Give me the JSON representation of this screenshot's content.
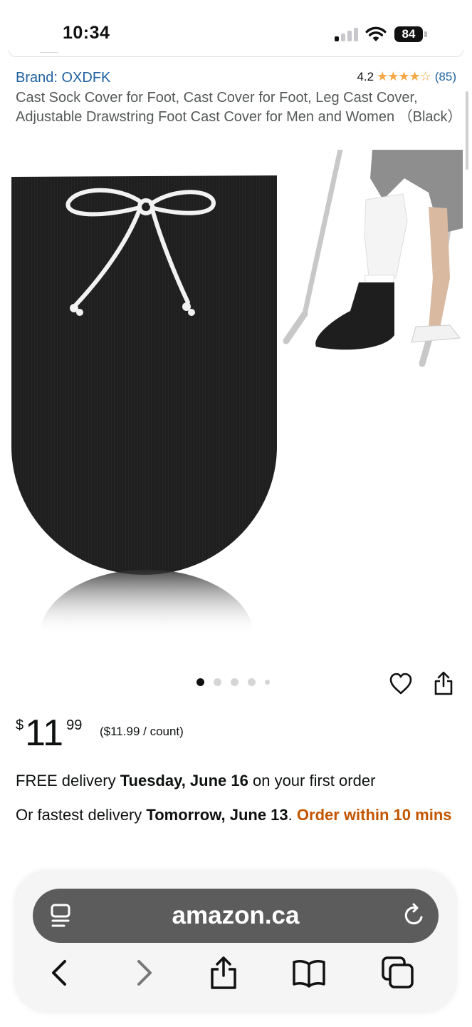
{
  "status": {
    "time": "10:34",
    "battery": "84"
  },
  "product": {
    "brand": "Brand: OXDFK",
    "rating_value": "4.2",
    "rating_stars": 4.2,
    "rating_count": "(85)",
    "title": "Cast Sock Cover for Foot, Cast Cover for Foot, Leg Cast Cover, Adjustable Drawstring Foot Cast Cover for Men and Women （Black）"
  },
  "gallery": {
    "count": 5,
    "active_index": 0
  },
  "price": {
    "symbol": "$",
    "whole": "11",
    "fraction": "99",
    "unit": "($11.99 / count)"
  },
  "delivery": {
    "prefix": "FREE delivery ",
    "date": "Tuesday, June 16",
    "suffix": " on your first order"
  },
  "fastest": {
    "prefix": "Or fastest delivery ",
    "date": "Tomorrow, June 13",
    "separator": ". ",
    "urgency": "Order within 10 mins"
  },
  "browser": {
    "url": "amazon.ca"
  },
  "colors": {
    "link": "#2162a1",
    "star": "#f3a847",
    "urgency": "#c45500",
    "url_bar": "#5c5c5c"
  },
  "icons": {
    "wishlist": "heart-icon",
    "share": "share-icon",
    "reader": "reader-mode-icon",
    "reload": "reload-icon",
    "back": "back-icon",
    "forward": "forward-icon",
    "bookmarks": "bookmarks-icon",
    "tabs": "tabs-icon"
  }
}
